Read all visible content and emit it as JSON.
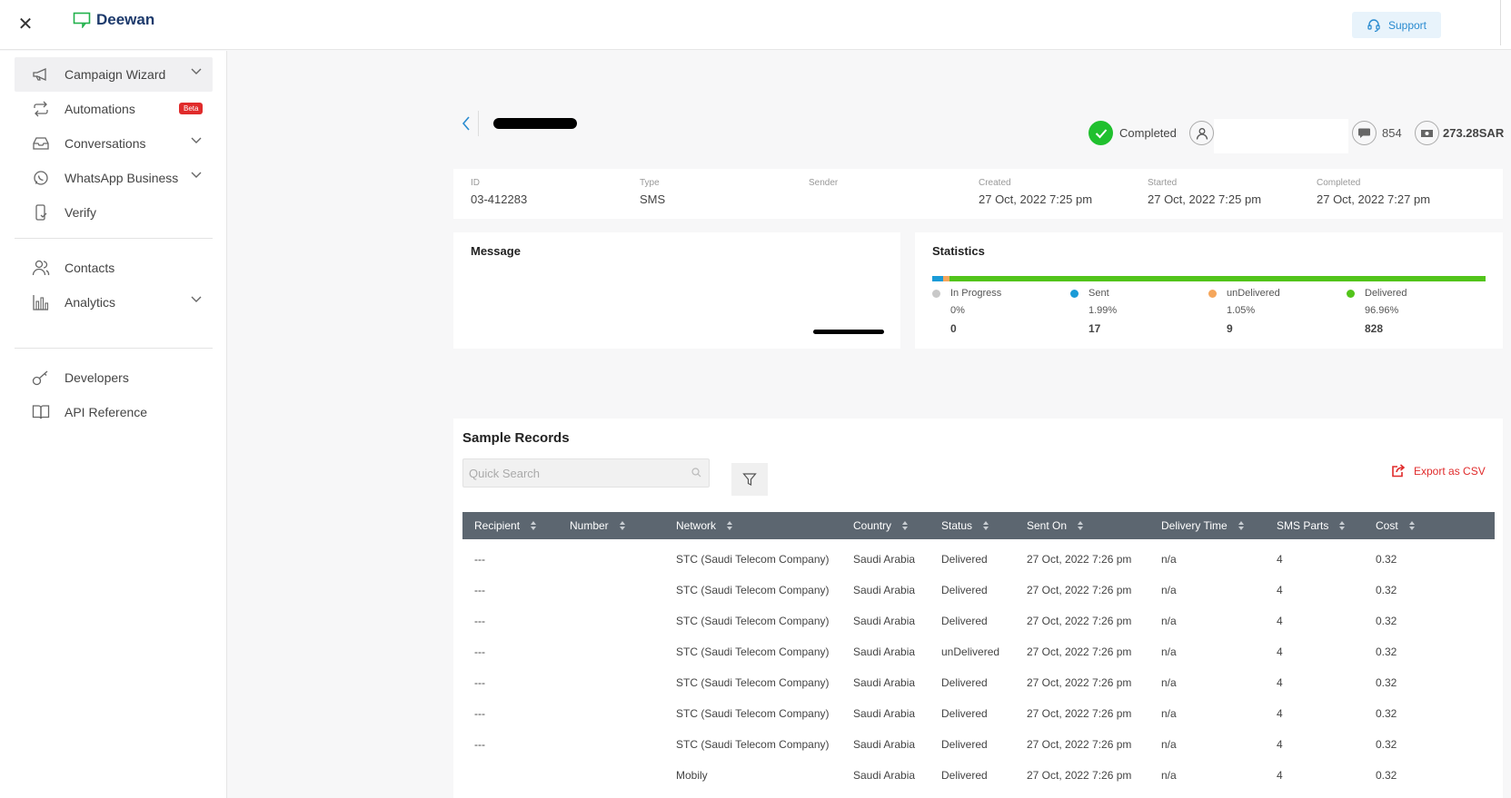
{
  "app": {
    "name": "Deewan",
    "support_label": "Support"
  },
  "sidebar": {
    "items": [
      {
        "label": "Campaign Wizard"
      },
      {
        "label": "Automations",
        "badge": "Beta"
      },
      {
        "label": "Conversations"
      },
      {
        "label": "WhatsApp Business"
      },
      {
        "label": "Verify"
      },
      {
        "label": "Contacts"
      },
      {
        "label": "Analytics"
      },
      {
        "label": "Developers"
      },
      {
        "label": "API Reference"
      }
    ]
  },
  "campaign": {
    "status": "Completed",
    "message_count": "854",
    "cost": "273.28SAR",
    "status_color": "#20c02e"
  },
  "info": [
    {
      "key": "ID",
      "value": "03-412283"
    },
    {
      "key": "Type",
      "value": "SMS"
    },
    {
      "key": "Sender",
      "value": ""
    },
    {
      "key": "Created",
      "value": "27 Oct, 2022  7:25 pm"
    },
    {
      "key": "Started",
      "value": "27 Oct, 2022  7:25 pm"
    },
    {
      "key": "Completed",
      "value": "27 Oct, 2022  7:27 pm"
    }
  ],
  "message": {
    "title": "Message"
  },
  "statistics": {
    "title": "Statistics",
    "items": [
      {
        "label": "In Progress",
        "percent": "0%",
        "count": "0",
        "color": "#c8c8c8"
      },
      {
        "label": "Sent",
        "percent": "1.99%",
        "count": "17",
        "color": "#1a9bd7"
      },
      {
        "label": "unDelivered",
        "percent": "1.05%",
        "count": "9",
        "color": "#f5a65b"
      },
      {
        "label": "Delivered",
        "percent": "96.96%",
        "count": "828",
        "color": "#52c41a"
      }
    ]
  },
  "records": {
    "title": "Sample Records",
    "search_placeholder": "Quick Search",
    "export_label": "Export as CSV",
    "columns": [
      "Recipient",
      "Number",
      "Network",
      "Country",
      "Status",
      "Sent On",
      "Delivery Time",
      "SMS Parts",
      "Cost"
    ],
    "rows": [
      [
        "---",
        "",
        "STC (Saudi Telecom Company)",
        "Saudi Arabia",
        "Delivered",
        "27 Oct, 2022 7:26 pm",
        "n/a",
        "4",
        "0.32"
      ],
      [
        "---",
        "",
        "STC (Saudi Telecom Company)",
        "Saudi Arabia",
        "Delivered",
        "27 Oct, 2022 7:26 pm",
        "n/a",
        "4",
        "0.32"
      ],
      [
        "---",
        "",
        "STC (Saudi Telecom Company)",
        "Saudi Arabia",
        "Delivered",
        "27 Oct, 2022 7:26 pm",
        "n/a",
        "4",
        "0.32"
      ],
      [
        "---",
        "",
        "STC (Saudi Telecom Company)",
        "Saudi Arabia",
        "unDelivered",
        "27 Oct, 2022 7:26 pm",
        "n/a",
        "4",
        "0.32"
      ],
      [
        "---",
        "",
        "STC (Saudi Telecom Company)",
        "Saudi Arabia",
        "Delivered",
        "27 Oct, 2022 7:26 pm",
        "n/a",
        "4",
        "0.32"
      ],
      [
        "---",
        "",
        "STC (Saudi Telecom Company)",
        "Saudi Arabia",
        "Delivered",
        "27 Oct, 2022 7:26 pm",
        "n/a",
        "4",
        "0.32"
      ],
      [
        "---",
        "",
        "STC (Saudi Telecom Company)",
        "Saudi Arabia",
        "Delivered",
        "27 Oct, 2022 7:26 pm",
        "n/a",
        "4",
        "0.32"
      ],
      [
        "",
        "",
        "Mobily",
        "Saudi Arabia",
        "Delivered",
        "27 Oct, 2022 7:26 pm",
        "n/a",
        "4",
        "0.32"
      ]
    ]
  }
}
